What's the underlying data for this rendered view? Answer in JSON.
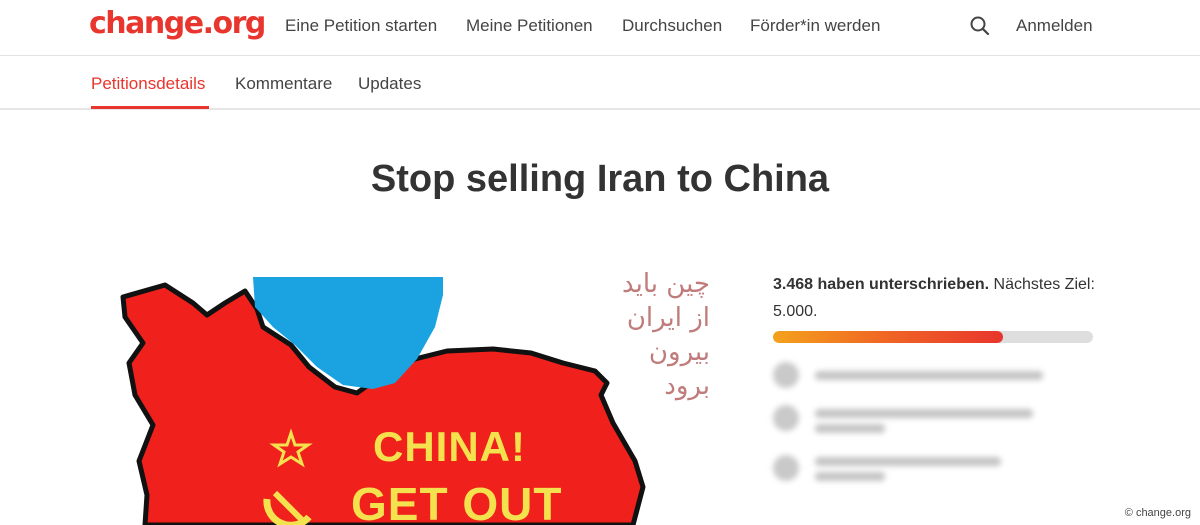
{
  "header": {
    "logo": "change.org",
    "nav": [
      "Eine Petition starten",
      "Meine Petitionen",
      "Durchsuchen",
      "Förder*in werden"
    ],
    "signin": "Anmelden"
  },
  "tabs": {
    "items": [
      "Petitionsdetails",
      "Kommentare",
      "Updates"
    ],
    "active_index": 0
  },
  "petition": {
    "title": "Stop selling Iran to China",
    "image_text": {
      "persian_lines": [
        "چین باید",
        "از ایران",
        "بیرون",
        "برود"
      ],
      "line1": "CHINA!",
      "line2": "GET OUT"
    }
  },
  "signatures": {
    "count_text": "3.468 haben unterschrieben.",
    "goal_text": "Nächstes Ziel: 5.000.",
    "count": 3468,
    "goal": 5000,
    "progress": 0.72
  },
  "watermark": "© change.org",
  "colors": {
    "brand": "#e8352d",
    "map_red": "#f0211c",
    "map_blue": "#1aa3e0",
    "text_yellow": "#f4e14e"
  }
}
